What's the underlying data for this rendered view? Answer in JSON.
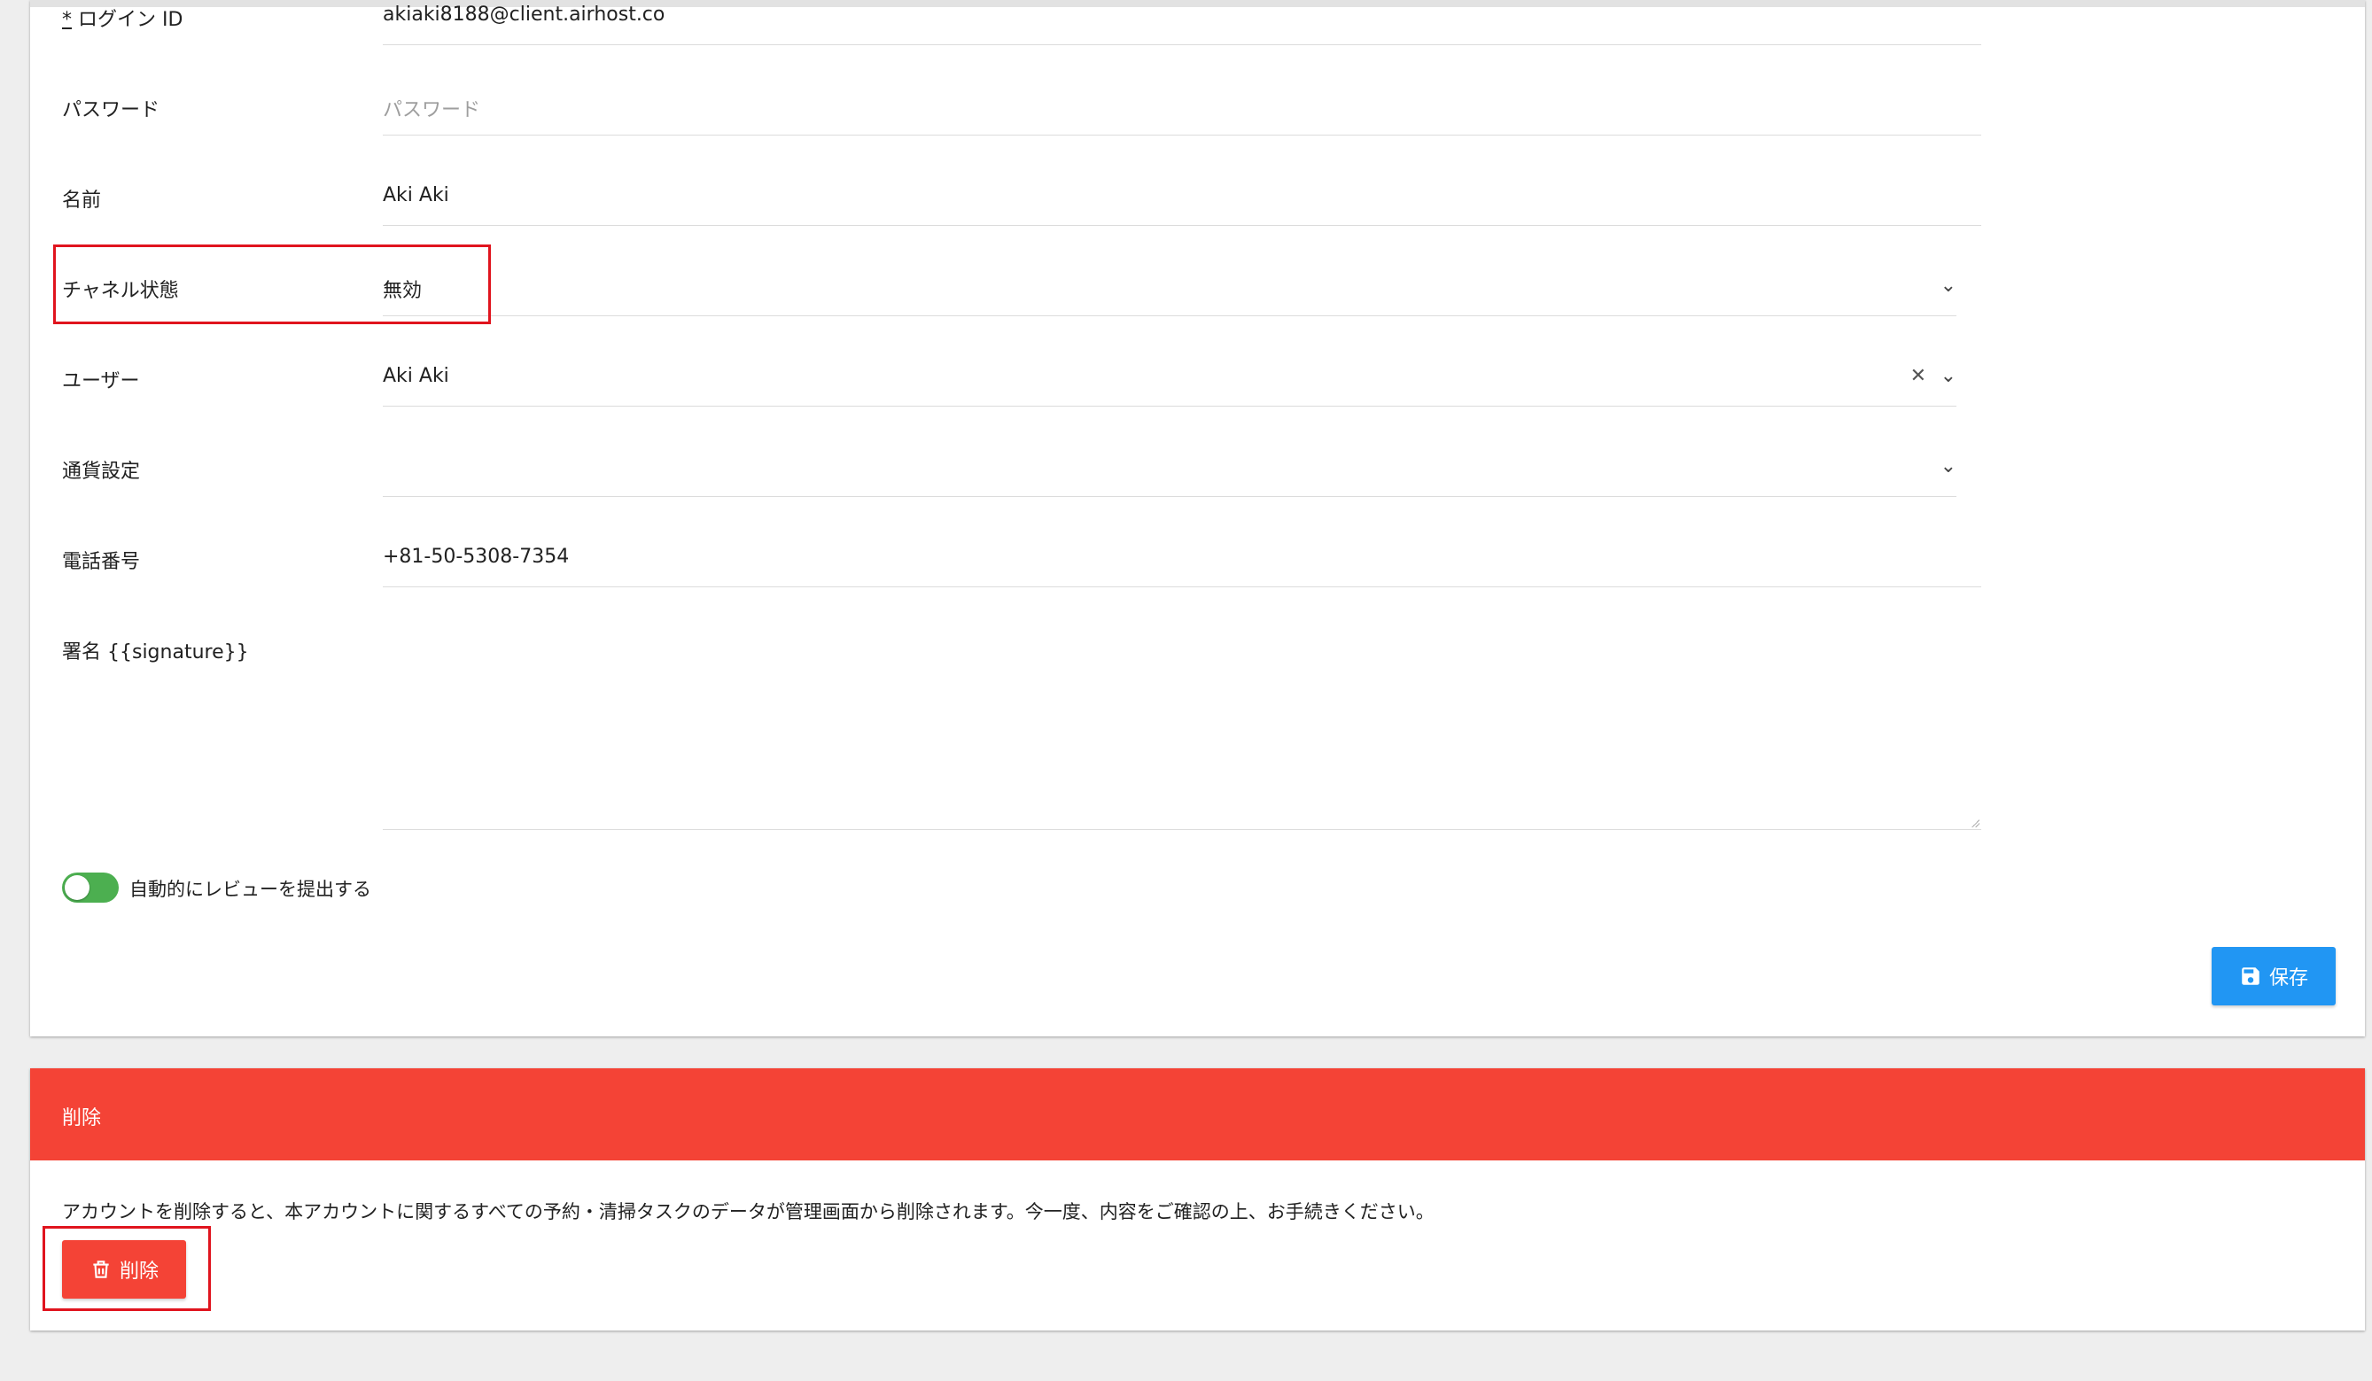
{
  "form": {
    "login_id": {
      "label_prefix": "*",
      "label": " ログイン ID",
      "value": "akiaki8188@client.airhost.co"
    },
    "password": {
      "label": "パスワード",
      "placeholder": "パスワード"
    },
    "name": {
      "label": "名前",
      "value": "Aki Aki"
    },
    "channel_status": {
      "label": "チャネル状態",
      "value": "無効"
    },
    "user": {
      "label": "ユーザー",
      "value": "Aki Aki"
    },
    "currency": {
      "label": "通貨設定",
      "value": ""
    },
    "phone": {
      "label": "電話番号",
      "value": "+81-50-5308-7354"
    },
    "signature": {
      "label": "署名 {{signature}}",
      "value": ""
    },
    "auto_review": {
      "label": "自動的にレビューを提出する",
      "enabled": true
    },
    "save_label": "保存",
    "icons": {
      "select": "chevron-down-icon",
      "clear": "close-icon",
      "save": "floppy-disk-icon"
    }
  },
  "danger_zone": {
    "title": "削除",
    "description": "アカウントを削除すると、本アカウントに関するすべての予約・清掃タスクのデータが管理画面から削除されます。今一度、内容をご確認の上、お手続きください。",
    "delete_label": "削除",
    "icons": {
      "delete": "trash-icon"
    }
  },
  "colors": {
    "primary": "#2196f3",
    "danger": "#f44336",
    "toggle_on": "#4caf50",
    "highlight": "#e0141e"
  }
}
